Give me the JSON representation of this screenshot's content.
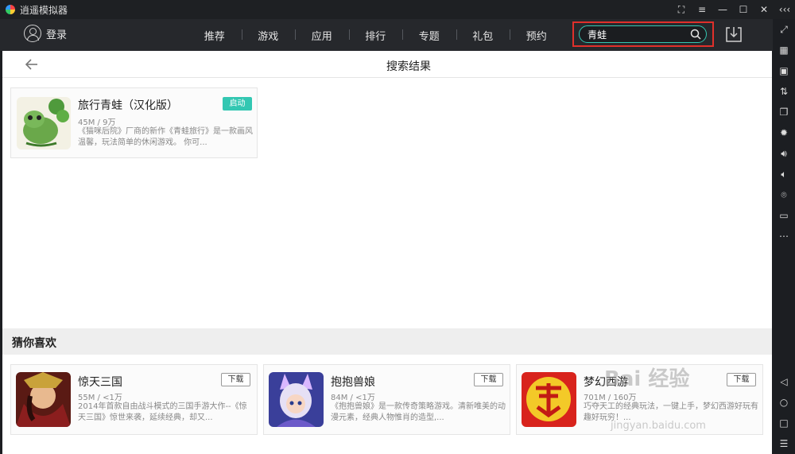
{
  "window": {
    "title": "逍遥模拟器",
    "controls": [
      "⛶",
      "≡",
      "—",
      "☐",
      "✕",
      "‹‹‹"
    ]
  },
  "header": {
    "login_label": "登录",
    "nav": [
      "推荐",
      "游戏",
      "应用",
      "排行",
      "专题",
      "礼包",
      "预约"
    ],
    "search": {
      "value": "青蛙",
      "placeholder": ""
    }
  },
  "subbar": {
    "title": "搜索结果"
  },
  "result": {
    "name": "旅行青蛙（汉化版）",
    "meta": "45M / 9万",
    "desc": "《猫咪后院》厂商的新作《青蛙旅行》是一款画风温馨，玩法简单的休闲游戏。 你可...",
    "action": "启动"
  },
  "guess": {
    "title": "猜你喜欢",
    "items": [
      {
        "name": "惊天三国",
        "meta": "55M / <1万",
        "desc": "2014年首款自由战斗模式的三国手游大作--《惊天三国》惊世来袭，延续经典，却又...",
        "action": "下载"
      },
      {
        "name": "抱抱兽娘",
        "meta": "84M / <1万",
        "desc": "《抱抱兽娘》是一款传奇策略游戏。清新唯美的动漫元素，经典人物惟肖的造型,...",
        "action": "下载"
      },
      {
        "name": "梦幻西游",
        "meta": "701M / 160万",
        "desc": "巧夺天工的经典玩法，一键上手，梦幻西游好玩有趣好玩穷！...",
        "action": "下载"
      }
    ]
  },
  "watermark": {
    "text": "Bai 经验",
    "sub": "jingyan.baidu.com"
  },
  "colors": {
    "accent": "#33c7b2",
    "highlight": "#e0302b",
    "bg_dark": "#26282c"
  }
}
